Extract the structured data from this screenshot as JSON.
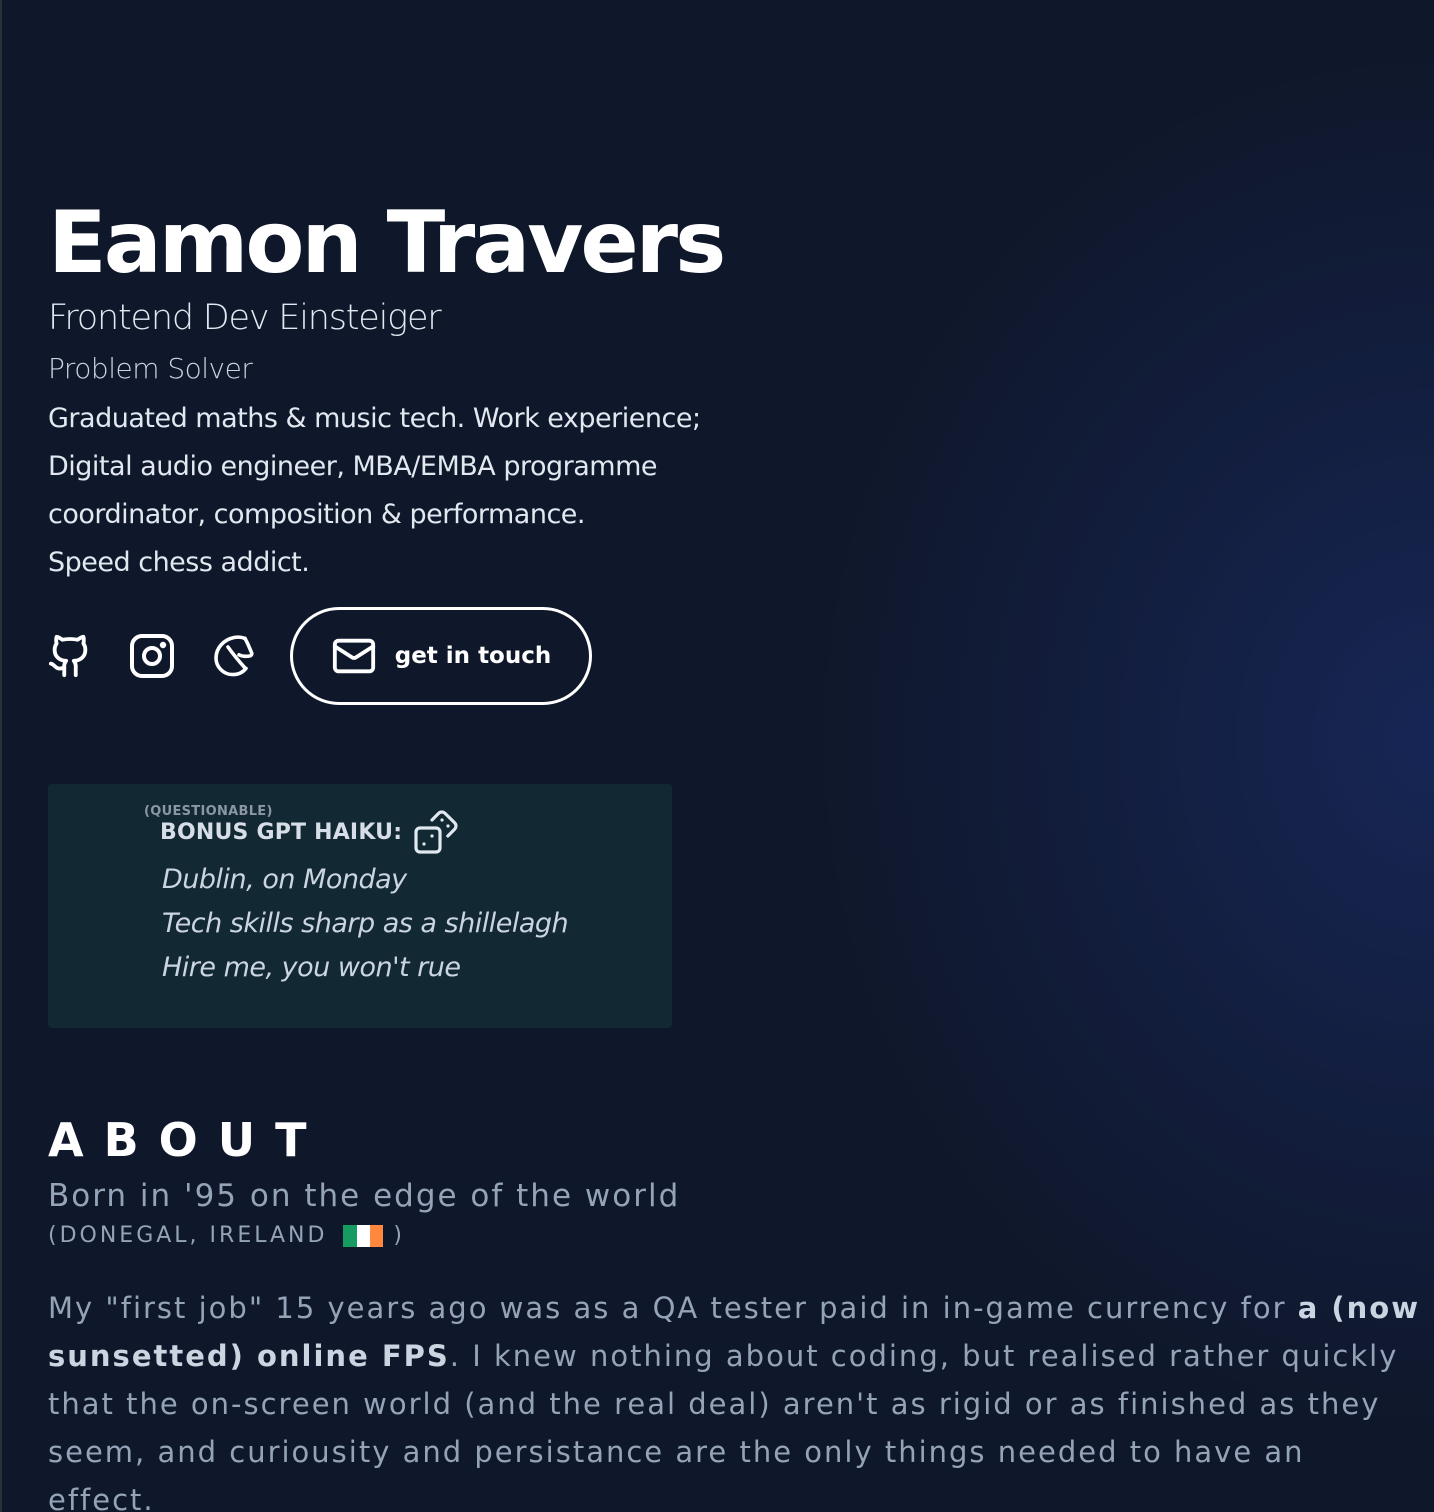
{
  "hero": {
    "name": "Eamon Travers",
    "role": "Frontend Dev Einsteiger",
    "subrole": "Problem Solver",
    "bio_lines": [
      "Graduated maths & music tech. Work experience;",
      "Digital audio engineer, MBA/EMBA programme",
      "coordinator, composition & performance.",
      "Speed chess addict."
    ]
  },
  "socials": {
    "icons": [
      "github-icon",
      "instagram-icon",
      "chess-knight-icon"
    ],
    "contact_button": {
      "icon": "mail-icon",
      "label": "get in touch"
    }
  },
  "haiku": {
    "qualifier": "(QUESTIONABLE)",
    "title": "BONUS GPT HAIKU:",
    "reroll_icon": "dice-icon",
    "lines": [
      "Dublin, on Monday",
      "Tech skills sharp as a shillelagh",
      "Hire me, you won't rue"
    ]
  },
  "about": {
    "heading": "ABOUT",
    "born": "Born in '95 on the edge of the world",
    "location_prefix": "(DONEGAL, IRELAND",
    "location_suffix": ")",
    "flag_colors": [
      "#169b62",
      "#ffffff",
      "#ff883e"
    ],
    "body": {
      "line1_a": "My \"first job\" 15 years ago was as a QA tester paid in in-game currency for ",
      "line1_b": "a (now",
      "line2_a": "sunsetted) online FPS",
      "line2_b": ". I knew nothing about coding, but realised rather quickly",
      "line3": "that the on-screen world (and the real deal) aren't as rigid or as finished as they",
      "line4": "seem, and curiousity and persistance are the only things needed to have an",
      "line5": "effect."
    }
  },
  "colors": {
    "background": "#0f172a",
    "card": "#122832",
    "text": "#e2e8f0",
    "muted": "#94a3b8"
  }
}
